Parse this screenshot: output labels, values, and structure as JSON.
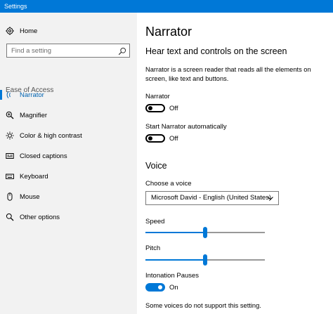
{
  "window": {
    "title": "Settings"
  },
  "sidebar": {
    "home_label": "Home",
    "search_placeholder": "Find a setting",
    "group_label": "Ease of Access",
    "items": [
      {
        "label": "Narrator",
        "icon": "narrator-icon",
        "active": true
      },
      {
        "label": "Magnifier",
        "icon": "magnifier-icon",
        "active": false
      },
      {
        "label": "Color & high contrast",
        "icon": "brightness-icon",
        "active": false
      },
      {
        "label": "Closed captions",
        "icon": "captions-icon",
        "active": false
      },
      {
        "label": "Keyboard",
        "icon": "keyboard-icon",
        "active": false
      },
      {
        "label": "Mouse",
        "icon": "mouse-icon",
        "active": false
      },
      {
        "label": "Other options",
        "icon": "options-icon",
        "active": false
      }
    ]
  },
  "main": {
    "title": "Narrator",
    "section1_title": "Hear text and controls on the screen",
    "description": "Narrator is a screen reader that reads all the elements on screen, like text and buttons.",
    "narrator_label": "Narrator",
    "narrator_state": "Off",
    "auto_label": "Start Narrator automatically",
    "auto_state": "Off",
    "voice_title": "Voice",
    "choose_voice_label": "Choose a voice",
    "voice_value": "Microsoft David - English (United States)",
    "speed_label": "Speed",
    "speed_value": 0.5,
    "pitch_label": "Pitch",
    "pitch_value": 0.5,
    "intonation_label": "Intonation Pauses",
    "intonation_state": "On",
    "note": "Some voices do not support this setting."
  },
  "colors": {
    "accent": "#0078d7",
    "sidebar_bg": "#f2f2f2"
  }
}
